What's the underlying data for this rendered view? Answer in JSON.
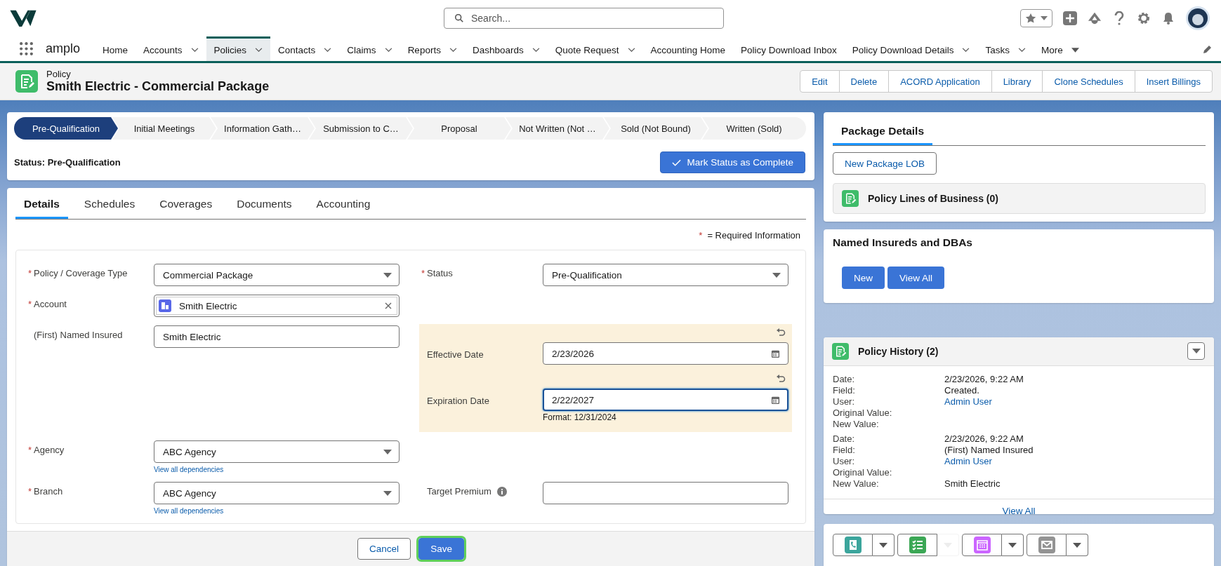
{
  "app": {
    "name": "amplo",
    "search_placeholder": "Search..."
  },
  "nav": [
    {
      "label": "Home",
      "kind": "tab",
      "menu": false,
      "selected": false
    },
    {
      "label": "Accounts",
      "kind": "tab",
      "menu": true,
      "selected": false
    },
    {
      "label": "Policies",
      "kind": "tab",
      "menu": true,
      "selected": true
    },
    {
      "label": "Contacts",
      "kind": "tab",
      "menu": true,
      "selected": false
    },
    {
      "label": "Claims",
      "kind": "tab",
      "menu": true,
      "selected": false
    },
    {
      "label": "Reports",
      "kind": "tab",
      "menu": true,
      "selected": false
    },
    {
      "label": "Dashboards",
      "kind": "tab",
      "menu": true,
      "selected": false
    },
    {
      "label": "Quote Request",
      "kind": "tab",
      "menu": true,
      "selected": false
    },
    {
      "label": "Accounting Home",
      "kind": "tab",
      "menu": false,
      "selected": false
    },
    {
      "label": "Policy Download Inbox",
      "kind": "tab",
      "menu": false,
      "selected": false
    },
    {
      "label": "Policy Download Details",
      "kind": "tab",
      "menu": true,
      "selected": false
    },
    {
      "label": "Tasks",
      "kind": "tab",
      "menu": true,
      "selected": false
    },
    {
      "label": "More",
      "kind": "overflow",
      "menu": true,
      "selected": false
    }
  ],
  "record": {
    "type": "Policy",
    "title": "Smith Electric - Commercial Package",
    "actions": [
      "Edit",
      "Delete",
      "ACORD Application",
      "Library",
      "Clone Schedules",
      "Insert Billings"
    ]
  },
  "path": {
    "stages": [
      {
        "label": "Pre-Qualification",
        "selected": true
      },
      {
        "label": "Initial Meetings",
        "selected": false
      },
      {
        "label": "Information Gath…",
        "selected": false
      },
      {
        "label": "Submission to C…",
        "selected": false
      },
      {
        "label": "Proposal",
        "selected": false
      },
      {
        "label": "Not Written (Not …",
        "selected": false
      },
      {
        "label": "Sold (Not Bound)",
        "selected": false
      },
      {
        "label": "Written (Sold)",
        "selected": false
      }
    ],
    "status": "Status: Pre-Qualification",
    "button": "Mark Status as Complete"
  },
  "tabs": [
    {
      "label": "Details",
      "selected": true
    },
    {
      "label": "Schedules",
      "selected": false
    },
    {
      "label": "Coverages",
      "selected": false
    },
    {
      "label": "Documents",
      "selected": false
    },
    {
      "label": "Accounting",
      "selected": false
    }
  ],
  "form": {
    "required_mark": "*",
    "required_note": "= Required Information",
    "rows": [
      {
        "left": [
          {
            "label": "Policy / Coverage Type",
            "kind": "select",
            "value": "Commercial Package",
            "required": true,
            "edited": false,
            "focused": false,
            "disabled": false
          }
        ],
        "right": [
          {
            "label": "Status",
            "kind": "select",
            "value": "Pre-Qualification",
            "required": true,
            "edited": false,
            "focused": false,
            "disabled": false
          }
        ]
      },
      {
        "left": [
          {
            "label": "Account",
            "kind": "lookup",
            "value": "Smith Electric",
            "required": true,
            "edited": false,
            "focused": false,
            "disabled": false
          }
        ]
      },
      {
        "left": [
          {
            "label": "(First) Named Insured",
            "kind": "text",
            "value": "Smith Electric",
            "required": false,
            "edited": false,
            "focused": false,
            "disabled": false
          }
        ],
        "right": [
          {
            "label": "Effective Date",
            "kind": "date",
            "value": "2/23/2026",
            "required": false,
            "edited": true,
            "focused": false,
            "disabled": false
          },
          {
            "label": "Expiration Date",
            "kind": "date",
            "value": "2/22/2027",
            "required": false,
            "edited": true,
            "focused": true,
            "disabled": false,
            "help": "Format: 12/31/2024"
          }
        ]
      },
      {
        "left": [
          {
            "label": "Agency",
            "kind": "select",
            "value": "ABC Agency",
            "required": true,
            "edited": false,
            "focused": false,
            "disabled": false,
            "link": "View all dependencies"
          }
        ]
      },
      {
        "left": [
          {
            "label": "Branch",
            "kind": "select",
            "value": "ABC Agency",
            "required": true,
            "edited": false,
            "focused": false,
            "disabled": false,
            "link": "View all dependencies"
          }
        ],
        "right": [
          {
            "label": "Target Premium",
            "kind": "text",
            "required": false,
            "edited": false,
            "focused": false,
            "disabled": false,
            "info": true
          }
        ]
      }
    ]
  },
  "footer": [
    {
      "label": "Cancel",
      "kind": "neutral",
      "focused": false
    },
    {
      "label": "Save",
      "kind": "brand",
      "focused": true
    }
  ],
  "package": {
    "tab": "Package Details",
    "button": "New Package LOB",
    "related": "Policy Lines of Business (0)"
  },
  "named_insureds": {
    "title": "Named Insureds and DBAs",
    "buttons": [
      "New",
      "View All"
    ]
  },
  "history": {
    "title": "Policy History (2)",
    "view_all": "View All",
    "entries": [
      {
        "rows": [
          {
            "label": "Date:",
            "value": "2/23/2026, 9:22 AM",
            "link": false
          },
          {
            "label": "Field:",
            "value": "Created.",
            "link": false
          },
          {
            "label": "User:",
            "value": "Admin User",
            "link": true
          },
          {
            "label": "Original Value:"
          },
          {
            "label": "New Value:"
          }
        ]
      },
      {
        "rows": [
          {
            "label": "Date:",
            "value": "2/23/2026, 9:22 AM",
            "link": false
          },
          {
            "label": "Field:",
            "value": "(First) Named Insured",
            "link": false
          },
          {
            "label": "User:",
            "value": "Admin User",
            "link": true
          },
          {
            "label": "Original Value:"
          },
          {
            "label": "New Value:",
            "value": "Smith Electric",
            "link": false
          }
        ]
      }
    ]
  },
  "activities": [
    {
      "kind": "call",
      "color": "#3ba59c",
      "disabled": false
    },
    {
      "kind": "task",
      "color": "#3ba755",
      "disabled": true
    },
    {
      "kind": "event",
      "color": "#cb65ff",
      "disabled": false
    },
    {
      "kind": "email",
      "color": "#939393",
      "disabled": false
    }
  ]
}
